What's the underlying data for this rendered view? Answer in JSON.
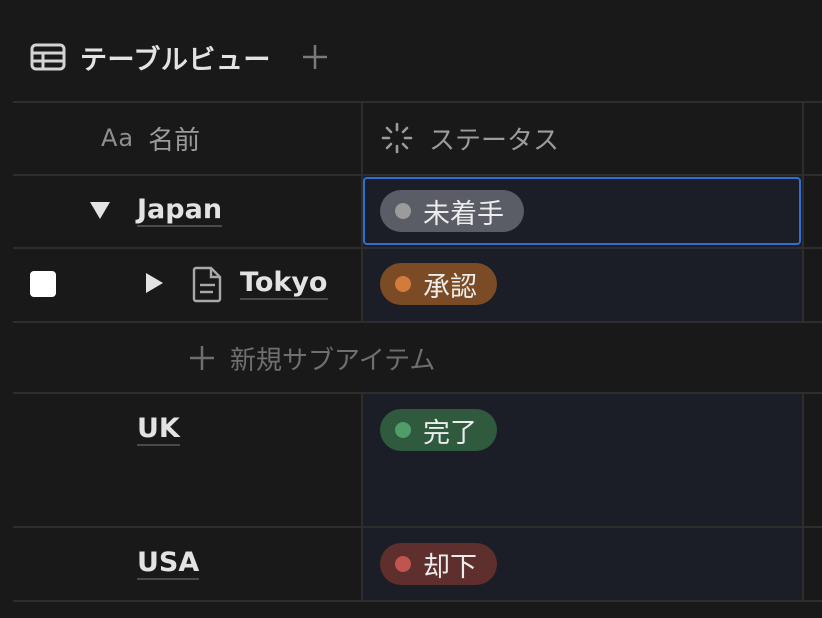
{
  "view": {
    "title": "テーブルビュー",
    "icon": "table-icon",
    "add_icon": "plus-icon"
  },
  "columns": {
    "name": {
      "prefix": "Aa",
      "label": "名前",
      "icon": "text-property-icon"
    },
    "status": {
      "label": "ステータス",
      "icon": "status-spinner-icon"
    }
  },
  "rows": [
    {
      "title": "Japan",
      "expanded": true,
      "status": "未着手",
      "status_color": "#9b9b9b",
      "pill_bg": "#5a5d66"
    },
    {
      "title": "Tokyo",
      "page_icon": "document-icon",
      "expanded": false,
      "status": "承認",
      "status_color": "#d27b3a",
      "pill_bg": "#7a4b24"
    },
    {
      "title": "UK",
      "status": "完了",
      "status_color": "#4f9e6a",
      "pill_bg": "#2f5a3e"
    },
    {
      "title": "USA",
      "status": "却下",
      "status_color": "#c0544f",
      "pill_bg": "#5e2f2d"
    }
  ],
  "new_subitem_label": "新規サブアイテム",
  "colors": {
    "background": "#191919",
    "selection": "#2f6fd1",
    "status_column_bg": "#1b1e26"
  }
}
